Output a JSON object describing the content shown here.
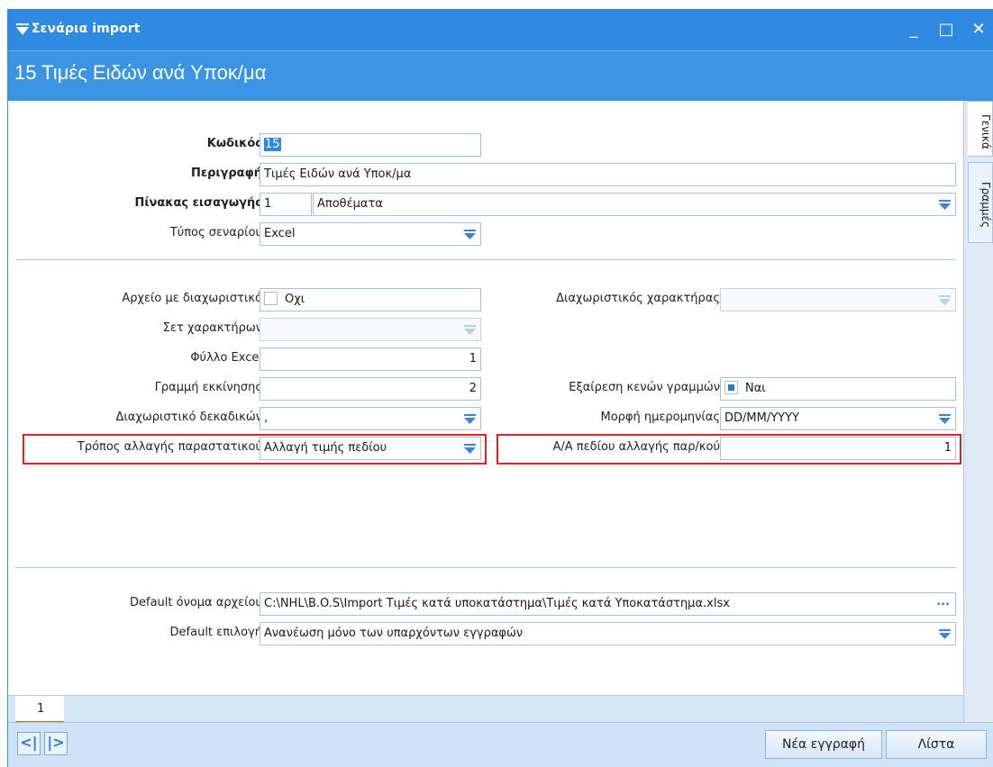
{
  "window": {
    "title": "Σενάρια import",
    "minimize": "_",
    "maximize": "□",
    "close": "✕"
  },
  "header": {
    "title": "15 Τιμές Ειδών ανά Υποκ/μα"
  },
  "side_tabs": {
    "general": "Γενικά",
    "lines": "Γραμμές"
  },
  "fields": {
    "code": {
      "label": "Κωδικός",
      "value": "15"
    },
    "description": {
      "label": "Περιγραφή",
      "value": "Τιμές Ειδών ανά Υποκ/μα"
    },
    "import_table": {
      "label": "Πίνακας εισαγωγής",
      "code": "1",
      "value": "Αποθέματα"
    },
    "scenario_type": {
      "label": "Τύπος σεναρίου",
      "value": "Excel"
    },
    "delimited_file": {
      "label": "Αρχείο με διαχωριστικό",
      "value": "Οχι"
    },
    "delimiter_char": {
      "label": "Διαχωριστικός χαρακτήρας",
      "value": ""
    },
    "charset": {
      "label": "Σετ χαρακτήρων",
      "value": ""
    },
    "excel_sheet": {
      "label": "Φύλλο Excel",
      "value": "1"
    },
    "start_row": {
      "label": "Γραμμή εκκίνησης",
      "value": "2"
    },
    "skip_empty_rows": {
      "label": "Εξαίρεση κενών γραμμών",
      "value": "Ναι"
    },
    "decimal_sep": {
      "label": "Διαχωριστικό δεκαδικών",
      "value": ","
    },
    "date_format": {
      "label": "Μορφή ημερομηνίας",
      "value": "DD/MM/YYYY"
    },
    "doc_change_mode": {
      "label": "Τρόπος αλλαγής παραστατικού",
      "value": "Αλλαγή τιμής πεδίου"
    },
    "doc_change_field": {
      "label": "Α/Α πεδίου αλλαγής παρ/κού",
      "value": "1"
    },
    "default_filename": {
      "label": "Default όνομα αρχείου",
      "value": "C:\\NHL\\B.O.S\\Import Τιμές κατά υποκατάστημα\\Τιμές κατά Υποκατάστημα.xlsx",
      "browse": "..."
    },
    "default_option": {
      "label": "Default επιλογή",
      "value": "Ανανέωση μόνο των υπαρχόντων εγγραφών"
    }
  },
  "bottom_tab": {
    "label": "1"
  },
  "footer": {
    "prev": "<|",
    "next": "|>",
    "new_record": "Νέα εγγραφή",
    "list": "Λίστα"
  },
  "colors": {
    "accent": "#2e8ae0",
    "highlight_border": "#e0202a"
  }
}
